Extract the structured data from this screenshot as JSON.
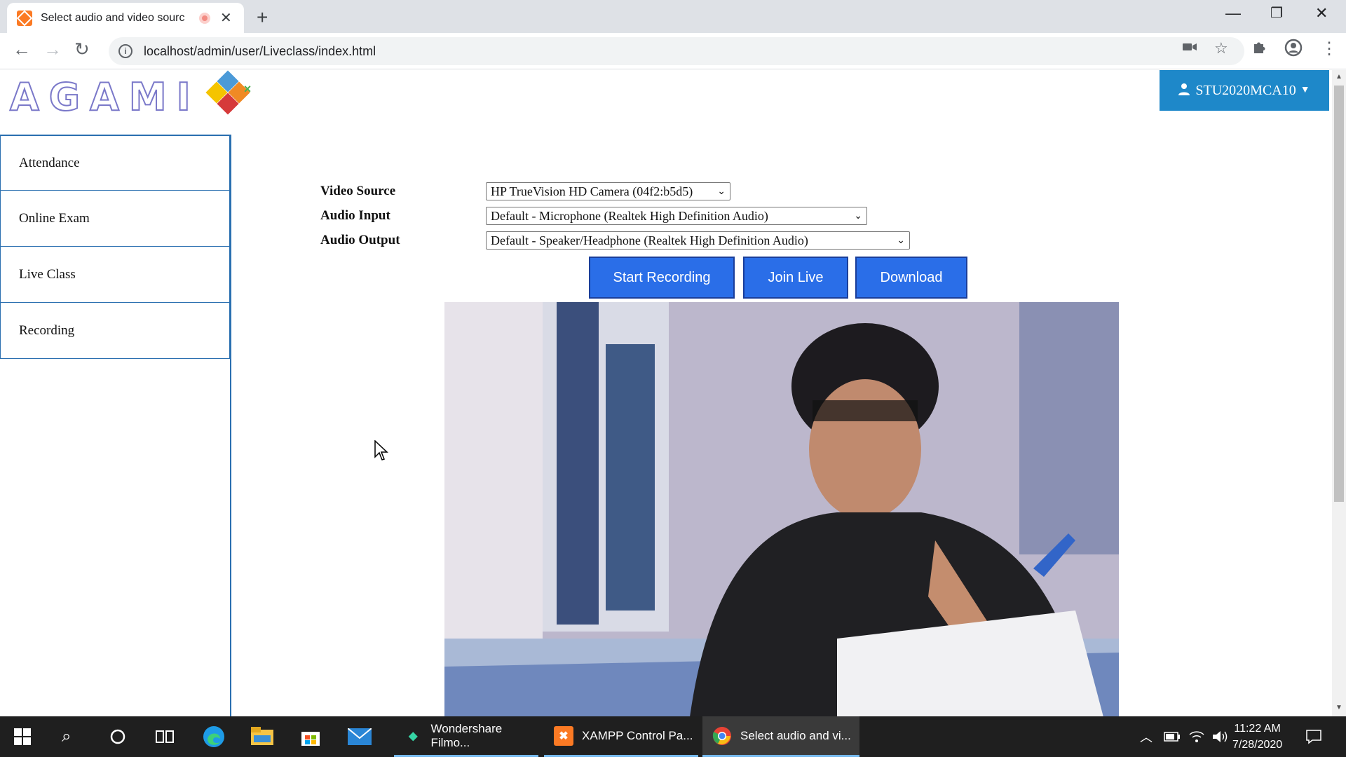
{
  "browser": {
    "tab_title": "Select audio and video sourc",
    "url": "localhost/admin/user/Liveclass/index.html"
  },
  "app": {
    "logo_text": "AGAMI",
    "user_label": "STU2020MCA10",
    "colors": {
      "accent": "#2a6ee8",
      "user_button": "#1e88c9",
      "sidebar_border": "#2a6fb0"
    }
  },
  "sidebar": {
    "items": [
      {
        "label": "Attendance"
      },
      {
        "label": "Online Exam"
      },
      {
        "label": "Live Class"
      },
      {
        "label": "Recording"
      }
    ]
  },
  "form": {
    "video_source": {
      "label": "Video Source",
      "value": "HP TrueVision HD Camera (04f2:b5d5)"
    },
    "audio_input": {
      "label": "Audio Input",
      "value": "Default - Microphone (Realtek High Definition Audio)"
    },
    "audio_output": {
      "label": "Audio Output",
      "value": "Default - Speaker/Headphone (Realtek High Definition Audio)"
    }
  },
  "buttons": {
    "start_recording": "Start Recording",
    "join_live": "Join Live",
    "download": "Download"
  },
  "taskbar": {
    "apps": [
      {
        "label": "Wondershare Filmo..."
      },
      {
        "label": "XAMPP Control Pa..."
      },
      {
        "label": "Select audio and vi..."
      }
    ],
    "time": "11:22 AM",
    "date": "7/28/2020"
  }
}
